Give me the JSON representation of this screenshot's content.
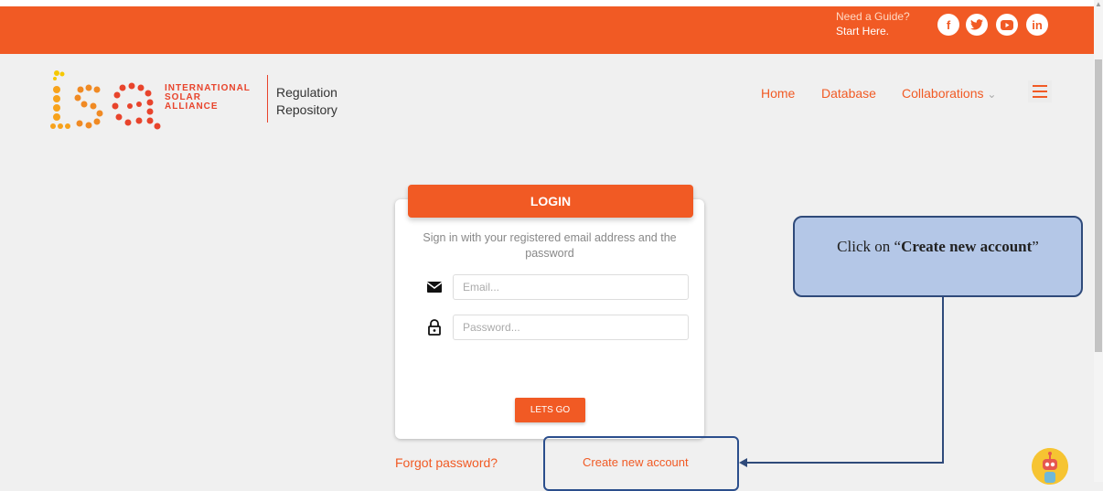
{
  "header": {
    "guide_line1": "Need a Guide?",
    "guide_line2": "Start Here.",
    "social": [
      {
        "label": "f",
        "icon": "facebook-icon"
      },
      {
        "label": "t",
        "icon": "twitter-icon"
      },
      {
        "label": "▶",
        "icon": "youtube-icon"
      },
      {
        "label": "in",
        "icon": "linkedin-icon"
      }
    ]
  },
  "brand": {
    "org_line1": "INTERNATIONAL",
    "org_line2": "SOLAR",
    "org_line3": "ALLIANCE",
    "repo_line1": "Regulation",
    "repo_line2": "Repository"
  },
  "nav": {
    "home": "Home",
    "database": "Database",
    "collaborations": "Collaborations",
    "collab_chevron": "⌄"
  },
  "login": {
    "title": "LOGIN",
    "instructions": "Sign in with your registered email address and the password",
    "email_placeholder": "Email...",
    "password_placeholder": "Password...",
    "submit_label": "LETS GO",
    "forgot_label": "Forgot password?",
    "create_label": "Create new account"
  },
  "callout": {
    "prefix": "Click on “",
    "bold": "Create new account",
    "suffix": "”"
  },
  "colors": {
    "brand_orange": "#f15a24",
    "callout_fill": "#b4c7e7",
    "callout_border": "#2f4a7a"
  }
}
